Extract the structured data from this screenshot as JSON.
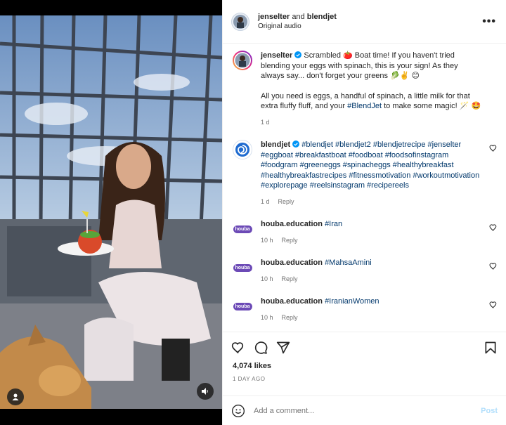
{
  "header": {
    "username": "jenselter",
    "connector": "and",
    "coauthor": "blendjet",
    "audio": "Original audio",
    "more_label": "•••"
  },
  "caption": {
    "username": "jenselter",
    "text_p1": "Scrambled 🍅 Boat time! If you haven't tried blending your eggs with spinach, this is your sign! As they always say... don't forget your greens 🥬✌️ 😊",
    "text_p2a": "All you need is eggs, a handful of spinach, a little milk for that extra fluffy fluff, and your ",
    "hashtag": "#BlendJet",
    "text_p2b": " to make some magic! 🪄 🤩",
    "time": "1 d"
  },
  "comments": [
    {
      "username": "blendjet",
      "text": "#blendjet #blendjet2 #blendjetrecipe #jenselter #eggboat #breakfastboat #foodboat #foodsofinstagram #foodgram #greeneggs #spinacheggs #healthybreakfast #healthybreakfastrecipes #fitnessmotivation #workoutmotivation #explorepage #reelsinstagram #recipereels",
      "time": "1 d",
      "reply": "Reply"
    },
    {
      "username": "houba.education",
      "text": "#Iran",
      "time": "10 h",
      "reply": "Reply"
    },
    {
      "username": "houba.education",
      "text": "#MahsaAmini",
      "time": "10 h",
      "reply": "Reply"
    },
    {
      "username": "houba.education",
      "text": "#IranianWomen",
      "time": "10 h",
      "reply": "Reply"
    }
  ],
  "likes": "4,074 likes",
  "time_ago": "1 DAY AGO",
  "add_comment": {
    "placeholder": "Add a comment...",
    "post_label": "Post"
  },
  "houba_logo": "houba",
  "colors": {
    "link": "#00376b",
    "muted": "#737373",
    "post": "#b2dffc",
    "verified": "#0095f6"
  }
}
